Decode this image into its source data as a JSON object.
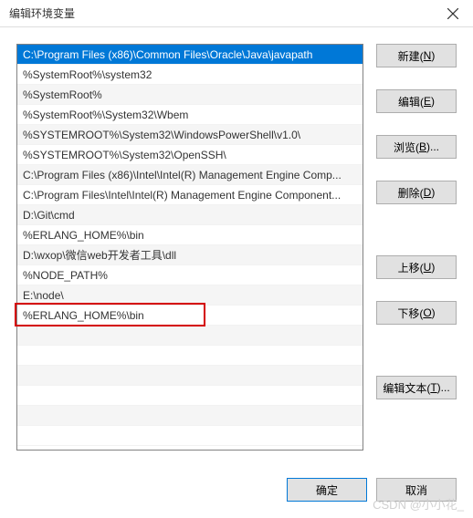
{
  "titlebar": {
    "title": "编辑环境变量"
  },
  "list": {
    "items": [
      "C:\\Program Files (x86)\\Common Files\\Oracle\\Java\\javapath",
      "%SystemRoot%\\system32",
      "%SystemRoot%",
      "%SystemRoot%\\System32\\Wbem",
      "%SYSTEMROOT%\\System32\\WindowsPowerShell\\v1.0\\",
      "%SYSTEMROOT%\\System32\\OpenSSH\\",
      "C:\\Program Files (x86)\\Intel\\Intel(R) Management Engine Comp...",
      "C:\\Program Files\\Intel\\Intel(R) Management Engine Component...",
      "D:\\Git\\cmd",
      "%ERLANG_HOME%\\bin",
      "D:\\wxop\\微信web开发者工具\\dll",
      "%NODE_PATH%",
      "E:\\node\\",
      "%ERLANG_HOME%\\bin"
    ],
    "selected_index": 0,
    "boxed_index": 13
  },
  "buttons": {
    "new": {
      "label": "新建(",
      "accel": "N",
      "tail": ")"
    },
    "edit": {
      "label": "编辑(",
      "accel": "E",
      "tail": ")"
    },
    "browse": {
      "label": "浏览(",
      "accel": "B",
      "tail": ")..."
    },
    "delete": {
      "label": "删除(",
      "accel": "D",
      "tail": ")"
    },
    "moveup": {
      "label": "上移(",
      "accel": "U",
      "tail": ")"
    },
    "movedown": {
      "label": "下移(",
      "accel": "O",
      "tail": ")"
    },
    "edittext": {
      "label": "编辑文本(",
      "accel": "T",
      "tail": ")..."
    }
  },
  "footer": {
    "ok": "确定",
    "cancel": "取消"
  },
  "watermark": "CSDN @小小花_"
}
